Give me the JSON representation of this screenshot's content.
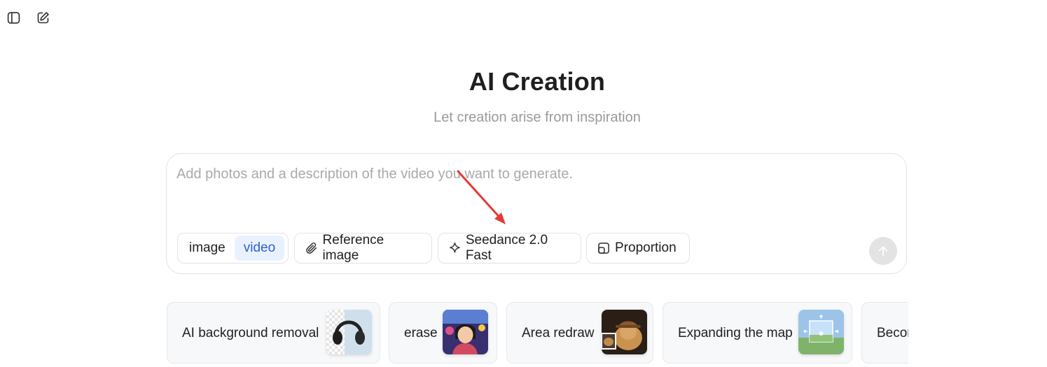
{
  "topbar": {
    "sidebar_toggle_icon": "sidebar-toggle-icon",
    "new_chat_icon": "edit-icon"
  },
  "hero": {
    "title": "AI Creation",
    "subtitle": "Let creation arise from inspiration"
  },
  "composer": {
    "placeholder": "Add photos and a description of the video you want to generate.",
    "value": "",
    "mode_options": [
      "image",
      "video"
    ],
    "mode_selected": "video",
    "reference_label": "Reference image",
    "model_label": "Seedance 2.0 Fast",
    "proportion_label": "Proportion",
    "send_icon": "arrow-up-icon"
  },
  "quick_actions": [
    {
      "label": "AI background removal",
      "icon": "headphones-thumbnail"
    },
    {
      "label": "erase",
      "icon": "girl-photo-thumbnail"
    },
    {
      "label": "Area redraw",
      "icon": "dog-photo-thumbnail"
    },
    {
      "label": "Expanding the map",
      "icon": "landscape-thumbnail"
    },
    {
      "label": "Becor"
    }
  ],
  "colors": {
    "accent": "#2b62c9",
    "accent_bg": "#eaf1fe",
    "annotation_arrow": "#e53935"
  }
}
